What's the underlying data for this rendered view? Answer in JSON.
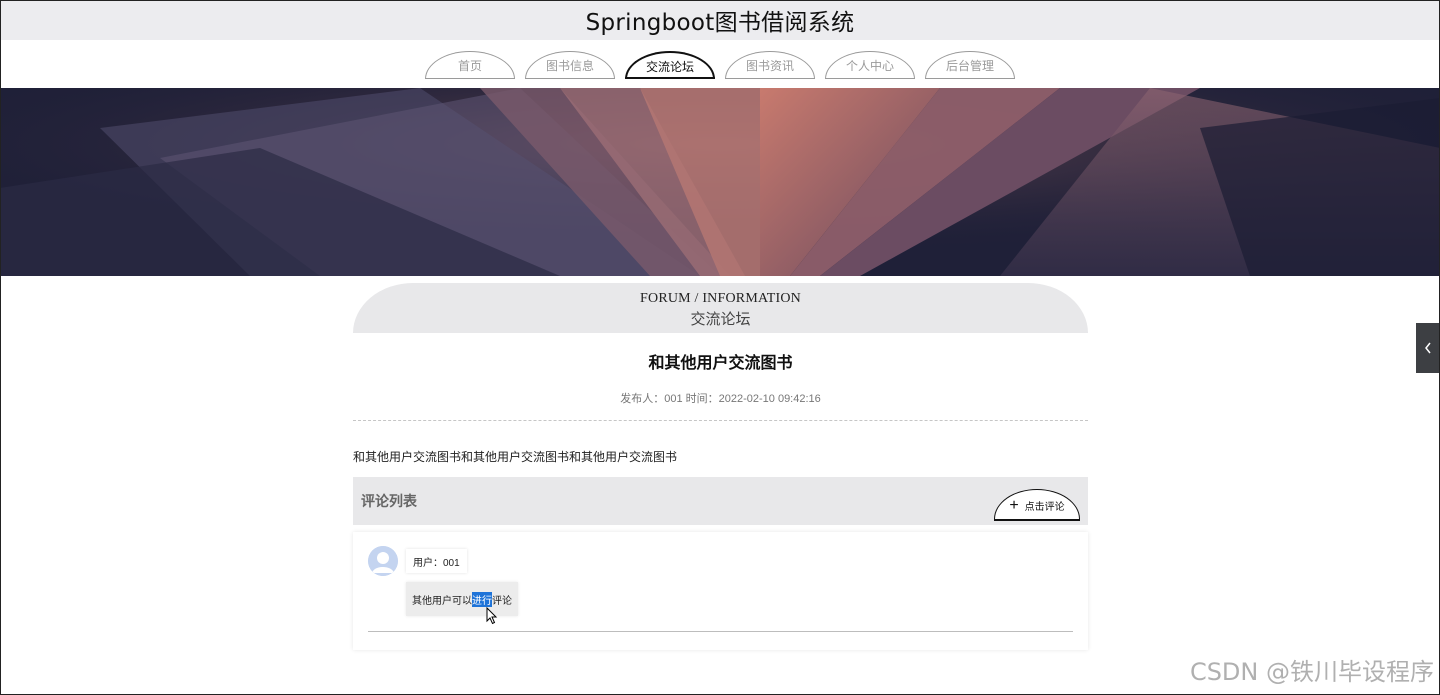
{
  "site": {
    "title": "Springboot图书借阅系统"
  },
  "nav": {
    "items": [
      {
        "label": "首页",
        "active": false
      },
      {
        "label": "图书信息",
        "active": false
      },
      {
        "label": "交流论坛",
        "active": true
      },
      {
        "label": "图书资讯",
        "active": false
      },
      {
        "label": "个人中心",
        "active": false
      },
      {
        "label": "后台管理",
        "active": false
      }
    ]
  },
  "section": {
    "title_en": "FORUM / INFORMATION",
    "title_zh": "交流论坛"
  },
  "post": {
    "title": "和其他用户交流图书",
    "meta": "发布人：001 时间：2022-02-10 09:42:16",
    "body": "和其他用户交流图书和其他用户交流图书和其他用户交流图书"
  },
  "comments": {
    "header": "评论列表",
    "add_button_label": "点击评论",
    "items": [
      {
        "user": "用户：001",
        "content_before": "其他用户可以",
        "content_selected": "进行",
        "content_after": "评论"
      }
    ]
  },
  "watermark": "CSDN @铁川毕设程序",
  "colors": {
    "header_bg": "#ececef",
    "panel_bg": "#e8e8ea",
    "selection": "#1e73d8",
    "side_toggle": "#3d3f43"
  }
}
